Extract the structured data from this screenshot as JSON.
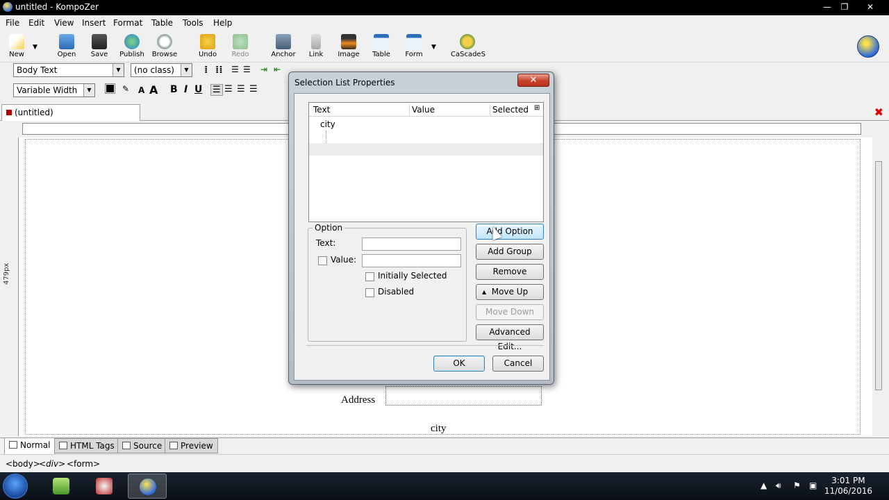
{
  "window": {
    "title": "untitled - KompoZer",
    "min": "—",
    "max": "❐",
    "close": "✕"
  },
  "menu": [
    "File",
    "Edit",
    "View",
    "Insert",
    "Format",
    "Table",
    "Tools",
    "Help"
  ],
  "toolbar": {
    "new": "New",
    "open": "Open",
    "save": "Save",
    "publish": "Publish",
    "browse": "Browse",
    "undo": "Undo",
    "redo": "Redo",
    "anchor": "Anchor",
    "link": "Link",
    "image": "Image",
    "table": "Table",
    "form": "Form",
    "cascades": "CaScadeS"
  },
  "format": {
    "paragraph": "Body Text",
    "class": "(no class)",
    "font": "Variable Width",
    "bold": "B",
    "italic": "I",
    "underline": "U"
  },
  "tab": {
    "label": "(untitled)"
  },
  "editor": {
    "ruler_px": "479px",
    "address_label": "Address",
    "city_label": "city"
  },
  "viewtabs": {
    "normal": "Normal",
    "html_tags": "HTML Tags",
    "source": "Source",
    "preview": "Preview"
  },
  "status": {
    "body": "<body>",
    "div": "<div>",
    "form": "<form>"
  },
  "taskbar": {
    "time": "3:01 PM",
    "date": "11/06/2016"
  },
  "dialog": {
    "title": "Selection List Properties",
    "close": "✕",
    "columns": {
      "text": "Text",
      "value": "Value",
      "selected": "Selected"
    },
    "tree_root": "city",
    "option_group": "Option",
    "text_label": "Text:",
    "text_value": "",
    "value_label": "Value:",
    "value_value": "",
    "initially_selected": "Initially Selected",
    "disabled": "Disabled",
    "add_option": "Add Option",
    "add_group": "Add Group",
    "remove": "Remove",
    "move_up": "Move Up",
    "move_down": "Move Down",
    "advanced_edit": "Advanced Edit...",
    "ok": "OK",
    "cancel": "Cancel"
  }
}
